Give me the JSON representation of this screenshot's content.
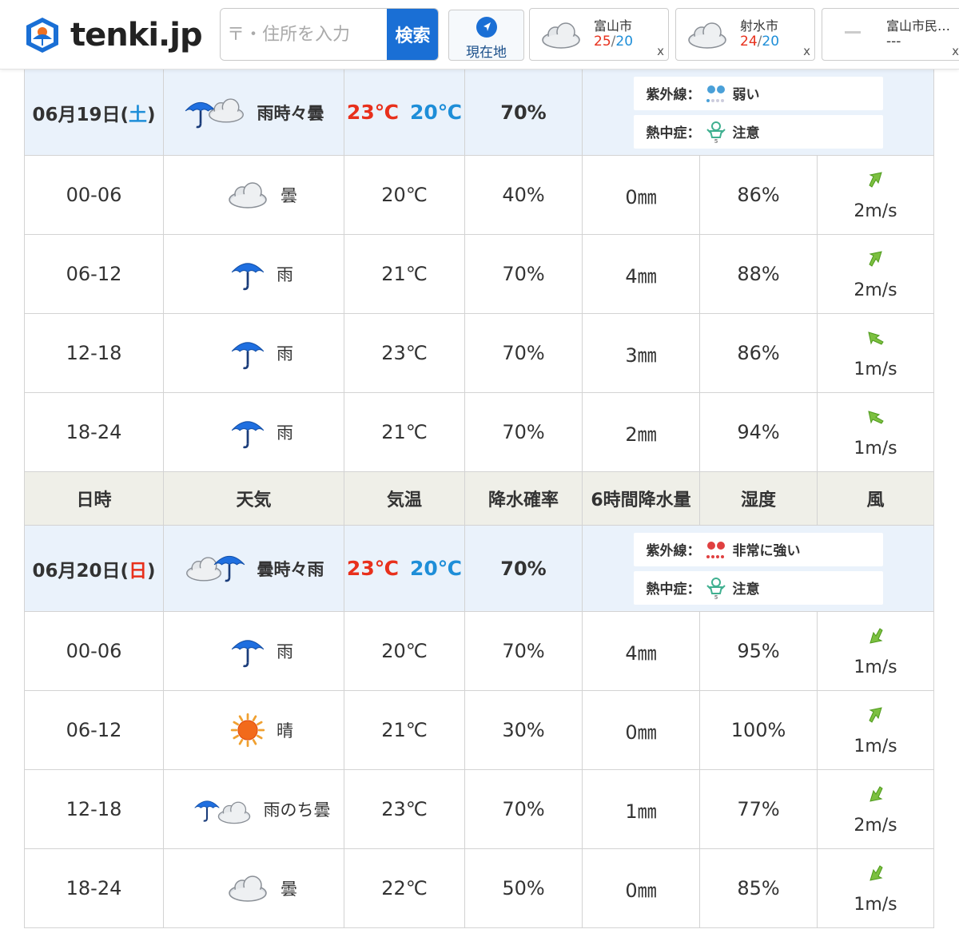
{
  "header": {
    "logo_text": "tenki.jp",
    "search": {
      "placeholder": "〒・住所を入力",
      "button": "検索"
    },
    "current_location": "現在地",
    "history": [
      {
        "city": "富山市",
        "high": "25",
        "low": "20",
        "close": "x"
      },
      {
        "city": "射水市",
        "high": "24",
        "low": "20",
        "close": "x"
      },
      {
        "city": "富山市民…",
        "temps": "---",
        "close": "x"
      }
    ]
  },
  "labels": {
    "uv": "紫外線：",
    "heat": "熱中症："
  },
  "columns": [
    "日時",
    "天気",
    "気温",
    "降水確率",
    "6時間降水量",
    "湿度",
    "風"
  ],
  "days": [
    {
      "date_prefix": "06月19日(",
      "weekday": "土",
      "date_suffix": ")",
      "weather": "雨時々曇",
      "icon": "rain-then-cloud",
      "high": "23℃",
      "low": "20℃",
      "pop": "70%",
      "uv": "弱い",
      "heat": "注意",
      "hours": [
        {
          "time": "00-06",
          "icon": "cloud",
          "weather": "曇",
          "temp": "20℃",
          "pop": "40%",
          "precip": "0㎜",
          "humidity": "86%",
          "wind": "2m/s",
          "wind_dir": "northeast-arrow"
        },
        {
          "time": "06-12",
          "icon": "umbrella",
          "weather": "雨",
          "temp": "21℃",
          "pop": "70%",
          "precip": "4㎜",
          "humidity": "88%",
          "wind": "2m/s",
          "wind_dir": "northeast-arrow"
        },
        {
          "time": "12-18",
          "icon": "umbrella",
          "weather": "雨",
          "temp": "23℃",
          "pop": "70%",
          "precip": "3㎜",
          "humidity": "86%",
          "wind": "1m/s",
          "wind_dir": "west-arrow"
        },
        {
          "time": "18-24",
          "icon": "umbrella",
          "weather": "雨",
          "temp": "21℃",
          "pop": "70%",
          "precip": "2㎜",
          "humidity": "94%",
          "wind": "1m/s",
          "wind_dir": "west-arrow"
        }
      ]
    },
    {
      "date_prefix": "06月20日(",
      "weekday": "日",
      "date_suffix": ")",
      "weather": "曇時々雨",
      "icon": "cloud-then-rain",
      "high": "23℃",
      "low": "20℃",
      "pop": "70%",
      "uv": "非常に強い",
      "heat": "注意",
      "hours": [
        {
          "time": "00-06",
          "icon": "umbrella",
          "weather": "雨",
          "temp": "20℃",
          "pop": "70%",
          "precip": "4㎜",
          "humidity": "95%",
          "wind": "1m/s",
          "wind_dir": "southwest-arrow"
        },
        {
          "time": "06-12",
          "icon": "sun",
          "weather": "晴",
          "temp": "21℃",
          "pop": "30%",
          "precip": "0㎜",
          "humidity": "100%",
          "wind": "1m/s",
          "wind_dir": "northeast-arrow"
        },
        {
          "time": "12-18",
          "icon": "rain-after-cloud",
          "weather": "雨のち曇",
          "temp": "23℃",
          "pop": "70%",
          "precip": "1㎜",
          "humidity": "77%",
          "wind": "2m/s",
          "wind_dir": "southwest-arrow"
        },
        {
          "time": "18-24",
          "icon": "cloud",
          "weather": "曇",
          "temp": "22℃",
          "pop": "50%",
          "precip": "0㎜",
          "humidity": "85%",
          "wind": "1m/s",
          "wind_dir": "southwest-arrow"
        }
      ]
    }
  ],
  "colors": {
    "accent": "#1a6fd5",
    "high": "#e8301c",
    "low": "#1e8ed8",
    "day_row": "#eaf2fb",
    "head_row": "#efefe8",
    "wind_arrow": "#7cc040"
  }
}
